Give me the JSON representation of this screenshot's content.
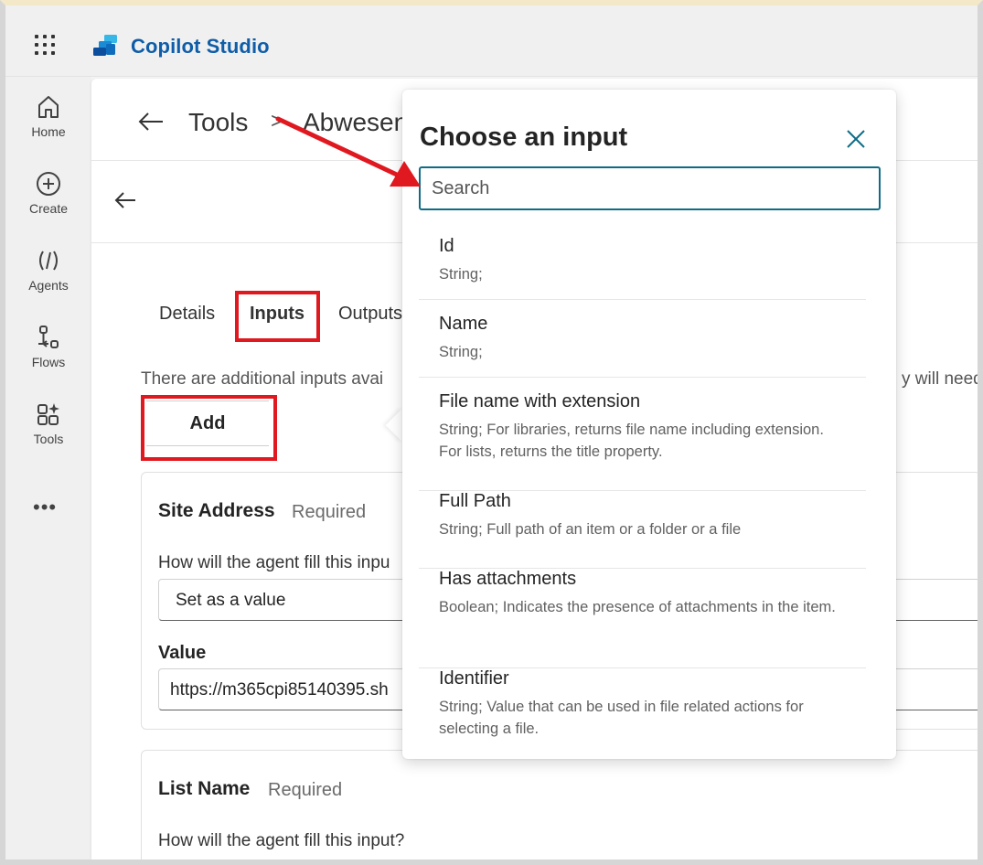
{
  "app": {
    "title": "Copilot Studio"
  },
  "rail": {
    "items": [
      {
        "label": "Home",
        "icon": "home-icon"
      },
      {
        "label": "Create",
        "icon": "plus-circle-icon"
      },
      {
        "label": "Agents",
        "icon": "agents-icon"
      },
      {
        "label": "Flows",
        "icon": "flows-icon"
      },
      {
        "label": "Tools",
        "icon": "tools-icon"
      }
    ],
    "more": "•••"
  },
  "breadcrumb": {
    "root": "Tools",
    "separator": ">",
    "current": "Abwesen"
  },
  "tabs": {
    "details": "Details",
    "inputs": "Inputs",
    "outputs": "Outputs"
  },
  "info": {
    "text": "There are additional inputs avai",
    "tail": "y will need"
  },
  "add_button": {
    "label": "Add"
  },
  "cards": [
    {
      "title": "Site Address",
      "required": "Required",
      "question": "How will the agent fill this inpu",
      "mode": "Set as a value",
      "value_label": "Value",
      "value": "https://m365cpi85140395.sh"
    },
    {
      "title": "List Name",
      "required": "Required",
      "question": "How will the agent fill this input?"
    }
  ],
  "popup": {
    "title": "Choose an input",
    "search_placeholder": "Search",
    "options": [
      {
        "name": "Id",
        "desc": "String;"
      },
      {
        "name": "Name",
        "desc": "String;"
      },
      {
        "name": "File name with extension",
        "desc": "String; For libraries, returns file name including extension. For lists, returns the title property."
      },
      {
        "name": "Full Path",
        "desc": "String; Full path of an item or a folder or a file"
      },
      {
        "name": "Has attachments",
        "desc": "Boolean; Indicates the presence of attachments in the item."
      },
      {
        "name": "Identifier",
        "desc": "String; Value that can be used in file related actions for selecting a file."
      }
    ]
  },
  "colors": {
    "brand": "#0f5da8",
    "annotation_red": "#e0181f",
    "focus_teal": "#0f6c87"
  }
}
